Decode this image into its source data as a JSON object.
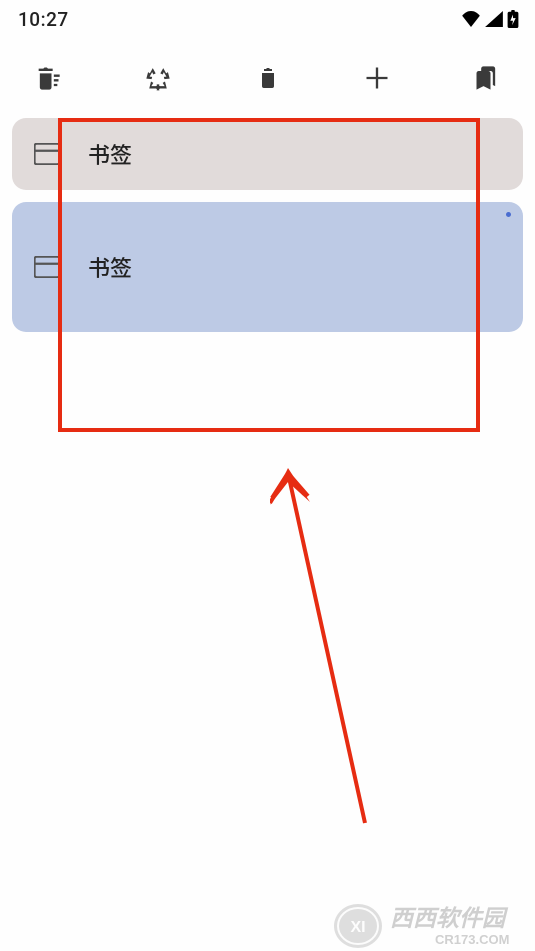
{
  "status": {
    "time": "10:27"
  },
  "toolbar": {
    "items": [
      {
        "name": "delete-sweep-icon"
      },
      {
        "name": "recycle-icon"
      },
      {
        "name": "restore-trash-icon"
      },
      {
        "name": "add-icon"
      },
      {
        "name": "bookmarks-icon"
      }
    ]
  },
  "list": {
    "items": [
      {
        "label": "书签",
        "highlighted": false
      },
      {
        "label": "书签",
        "highlighted": true
      }
    ]
  },
  "watermark": {
    "brand": "西西软件园",
    "url": "CR173.COM"
  }
}
